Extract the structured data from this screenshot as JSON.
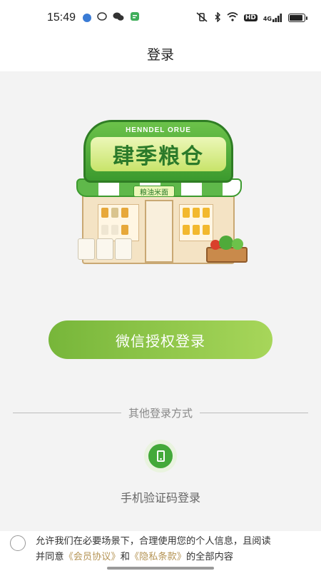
{
  "status_bar": {
    "time": "15:49",
    "notification_icons": [
      "browser-icon",
      "chat-bubble-icon",
      "wechat-icon",
      "message-icon"
    ],
    "right_icons": [
      "mute-vibrate-icon",
      "bluetooth-icon",
      "wifi-icon",
      "hd-icon",
      "signal-4g-icon",
      "battery-icon"
    ],
    "hd_label": "HD",
    "network_label": "4G"
  },
  "header": {
    "title": "登录"
  },
  "shop": {
    "arc_text": "HENNDEL ORUE",
    "name": "肆季粮仓",
    "tag": "粮油米面"
  },
  "wechat_login": {
    "label": "微信授权登录"
  },
  "divider": {
    "label": "其他登录方式"
  },
  "phone_login": {
    "label": "手机验证码登录",
    "icon": "phone-icon"
  },
  "agreement": {
    "line1": "允许我们在必要场景下，合理使用您的个人信息，且阅读",
    "prefix": "并同意",
    "member_link": "《会员协议》",
    "and": "和",
    "privacy_link": "《隐私条款》",
    "suffix": "的全部内容"
  },
  "colors": {
    "accent_green": "#43a93a",
    "button_gradient_start": "#77b63a",
    "button_gradient_end": "#a7d65a",
    "link_gold": "#b59455"
  }
}
